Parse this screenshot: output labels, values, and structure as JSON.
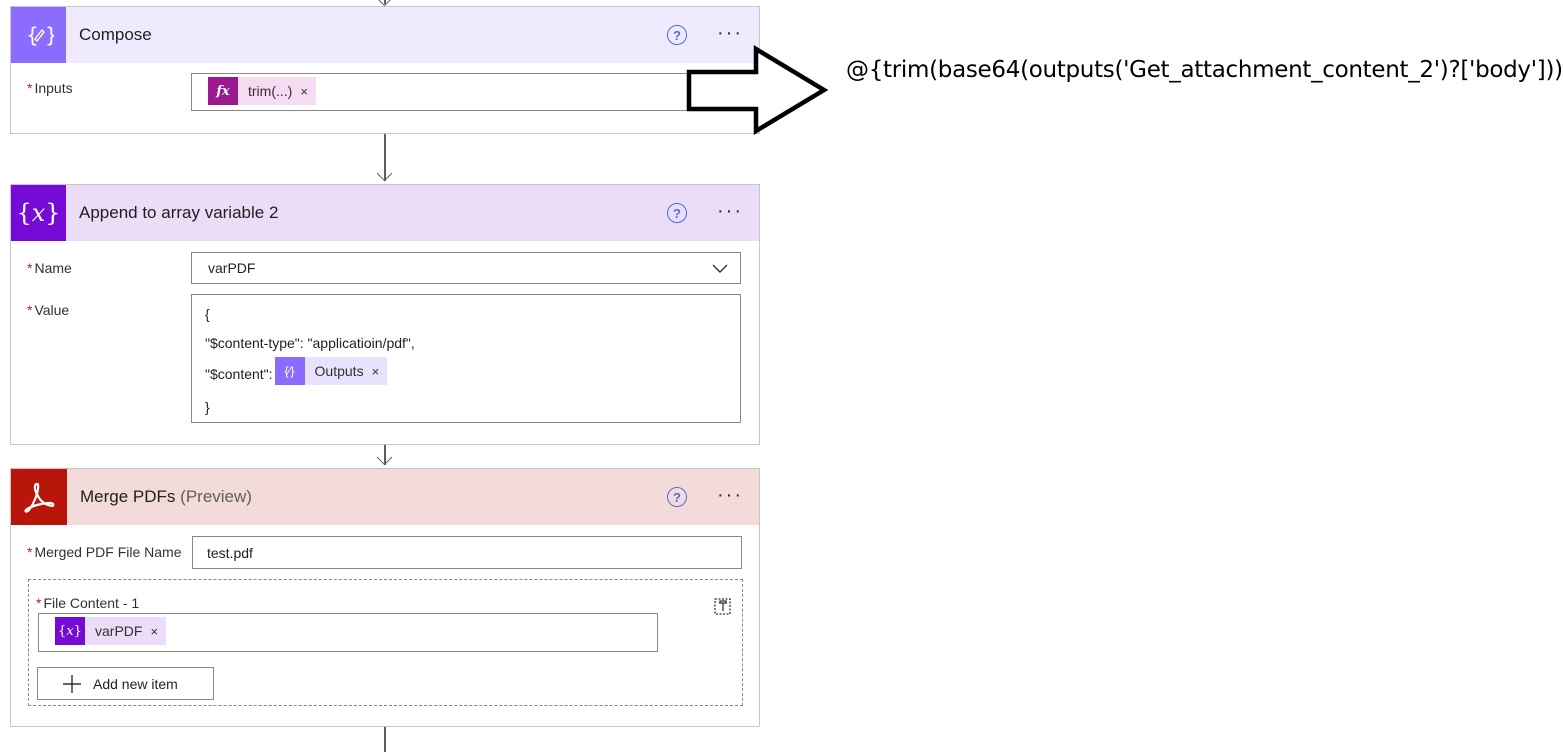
{
  "compose": {
    "title": "Compose",
    "inputs_label": "Inputs",
    "inputs_token": "trim(...)",
    "token_remove": "×"
  },
  "append": {
    "title": "Append to array variable 2",
    "name_label": "Name",
    "name_value": "varPDF",
    "value_label": "Value",
    "value_lines": [
      "{",
      "\"$content-type\": \"applicatioin/pdf\",",
      "\"$content\":",
      "}"
    ],
    "value_token": "Outputs",
    "token_remove": "×"
  },
  "merge": {
    "title": "Merge PDFs",
    "subtitle": "(Preview)",
    "file_name_label": "Merged PDF File Name",
    "file_name_value": "test.pdf",
    "file_content_label": "File Content - 1",
    "file_content_token": "varPDF",
    "token_remove": "×",
    "add_item_label": "Add new item"
  },
  "common": {
    "help_glyph": "?",
    "more_glyph": "···",
    "required_marker": "*"
  },
  "annotation": {
    "expression": "@{trim(base64(outputs('Get_attachment_content_2')?['body']))}"
  },
  "colors": {
    "compose_header": "#efeafd",
    "compose_icon": "#8c6cff",
    "variable_header": "#ebdcf7",
    "variable_icon": "#770bd6",
    "merge_header": "#f3dbd9",
    "merge_icon": "#b8150b",
    "fx_token": "#9a1a8e",
    "accent_blue": "#4f6bed"
  },
  "icons": {
    "compose": "compose-braces-icon",
    "variable": "variable-x-icon",
    "merge": "acrobat-icon",
    "help": "help-circle-icon",
    "more": "more-dots-icon",
    "dropdown": "chevron-down-icon",
    "delete": "delete-item-icon",
    "add": "plus-icon"
  }
}
